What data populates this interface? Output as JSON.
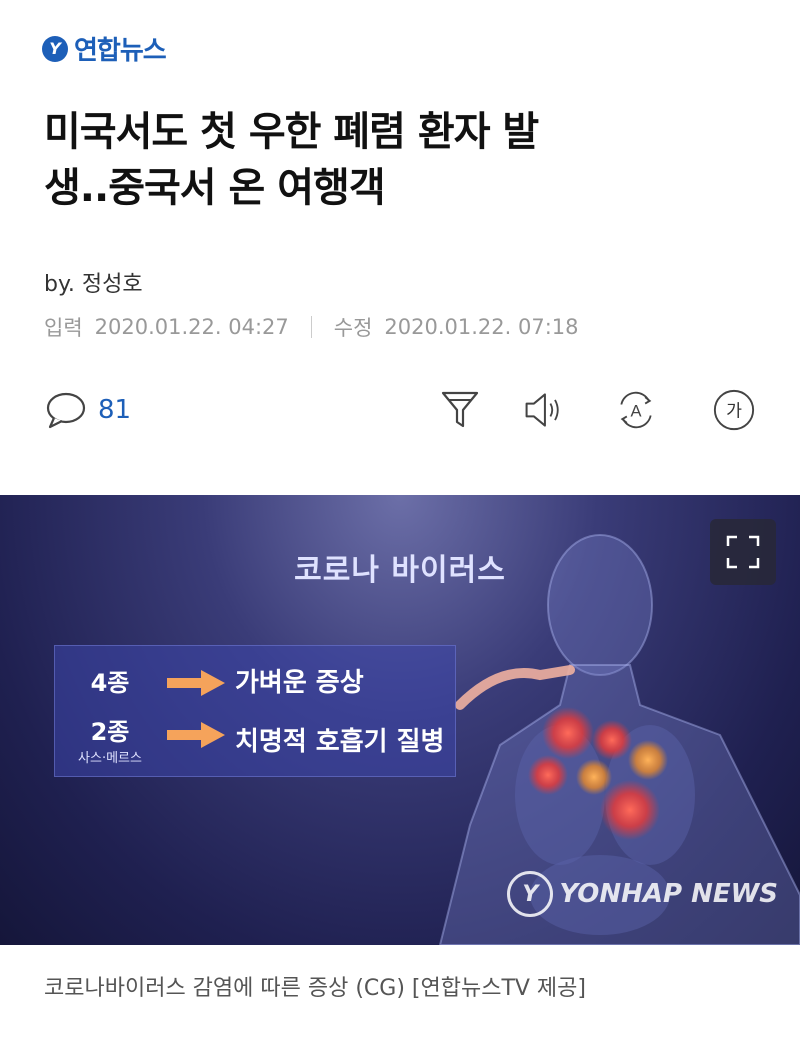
{
  "brand": {
    "logo_letter": "Y",
    "name": "연합뉴스",
    "color": "#1d5fb8"
  },
  "article": {
    "title_line1": "미국서도 첫 우한 폐렴 환자 발",
    "title_line2": "생..중국서 온 여행객",
    "byline": "by. 정성호",
    "published_label": "입력",
    "published": "2020.01.22. 04:27",
    "updated_label": "수정",
    "updated": "2020.01.22. 07:18"
  },
  "toolbar": {
    "comment_count": "81",
    "icons": [
      "comment-icon",
      "filter-icon",
      "speaker-icon",
      "translate-icon",
      "font-size-icon"
    ],
    "font_size_label": "가",
    "translate_label": "A"
  },
  "photo": {
    "title": "코로나 바이러스",
    "rows": [
      {
        "key": "4종",
        "sub": "",
        "value": "가벼운 증상"
      },
      {
        "key": "2종",
        "sub": "사스·메르스",
        "value": "치명적 호흡기 질병"
      }
    ],
    "watermark": "YONHAP NEWS"
  },
  "caption": "코로나바이러스 감염에 따른 증상 (CG) [연합뉴스TV 제공]"
}
